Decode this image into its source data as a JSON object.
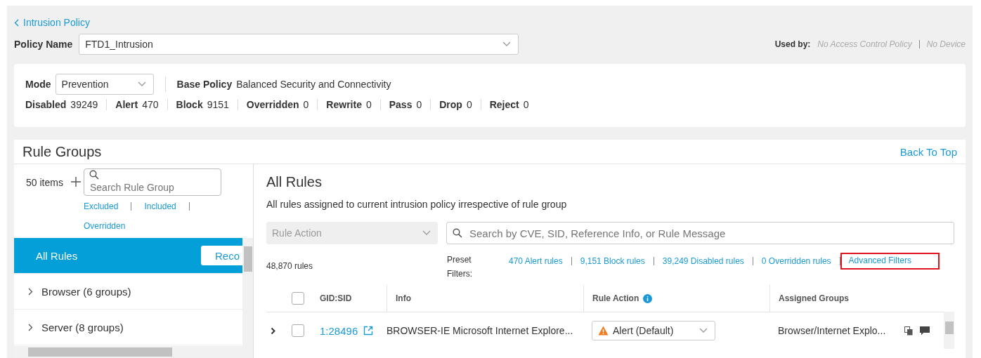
{
  "back_link": "Intrusion Policy",
  "policy_name": {
    "label": "Policy Name",
    "value": "FTD1_Intrusion"
  },
  "used_by": {
    "label": "Used by:",
    "items": [
      "No Access Control Policy",
      "No Device"
    ]
  },
  "summary": {
    "mode": {
      "label": "Mode",
      "value": "Prevention"
    },
    "base_policy": {
      "label": "Base Policy",
      "value": "Balanced Security and Connectivity"
    },
    "counts": [
      {
        "label": "Disabled",
        "value": "39249"
      },
      {
        "label": "Alert",
        "value": "470"
      },
      {
        "label": "Block",
        "value": "9151"
      },
      {
        "label": "Overridden",
        "value": "0"
      },
      {
        "label": "Rewrite",
        "value": "0"
      },
      {
        "label": "Pass",
        "value": "0"
      },
      {
        "label": "Drop",
        "value": "0"
      },
      {
        "label": "Reject",
        "value": "0"
      }
    ]
  },
  "rule_groups": {
    "title": "Rule Groups",
    "back_to_top": "Back To Top",
    "count": "50 items",
    "search": {
      "placeholder": "Search Rule Group"
    },
    "filters": [
      "Excluded",
      "Included",
      "Overridden"
    ],
    "items": [
      {
        "label": "All Rules",
        "selected": true,
        "button": "Reco"
      },
      {
        "label": "Browser (6 groups)",
        "selected": false,
        "expanded": false
      },
      {
        "label": "Server (8 groups)",
        "selected": false,
        "expanded": false
      }
    ]
  },
  "rules": {
    "title": "All Rules",
    "description": "All rules assigned to current intrusion policy irrespective of rule group",
    "action_select": {
      "placeholder": "Rule Action"
    },
    "search": {
      "placeholder": "Search by CVE, SID, Reference Info, or Rule Message"
    },
    "count": "48,870 rules",
    "preset_label": "Preset Filters:",
    "presets": [
      {
        "label": "470 Alert rules",
        "highlighted": false
      },
      {
        "label": "9,151 Block rules",
        "highlighted": false
      },
      {
        "label": "39,249 Disabled rules",
        "highlighted": false
      },
      {
        "label": "0 Overridden rules",
        "highlighted": false
      },
      {
        "label": "Advanced Filters",
        "highlighted": true
      }
    ],
    "columns": [
      "GID:SID",
      "Info",
      "Rule Action",
      "Assigned Groups"
    ],
    "select_all_checked": false,
    "rows": [
      {
        "sid": "1:28496",
        "info": "BROWSER-IE Microsoft Internet Explore...",
        "action": "Alert (Default)",
        "kind": "alert",
        "groups": "Browser/Internet Explo...",
        "checked": false,
        "expanded": false
      }
    ]
  }
}
